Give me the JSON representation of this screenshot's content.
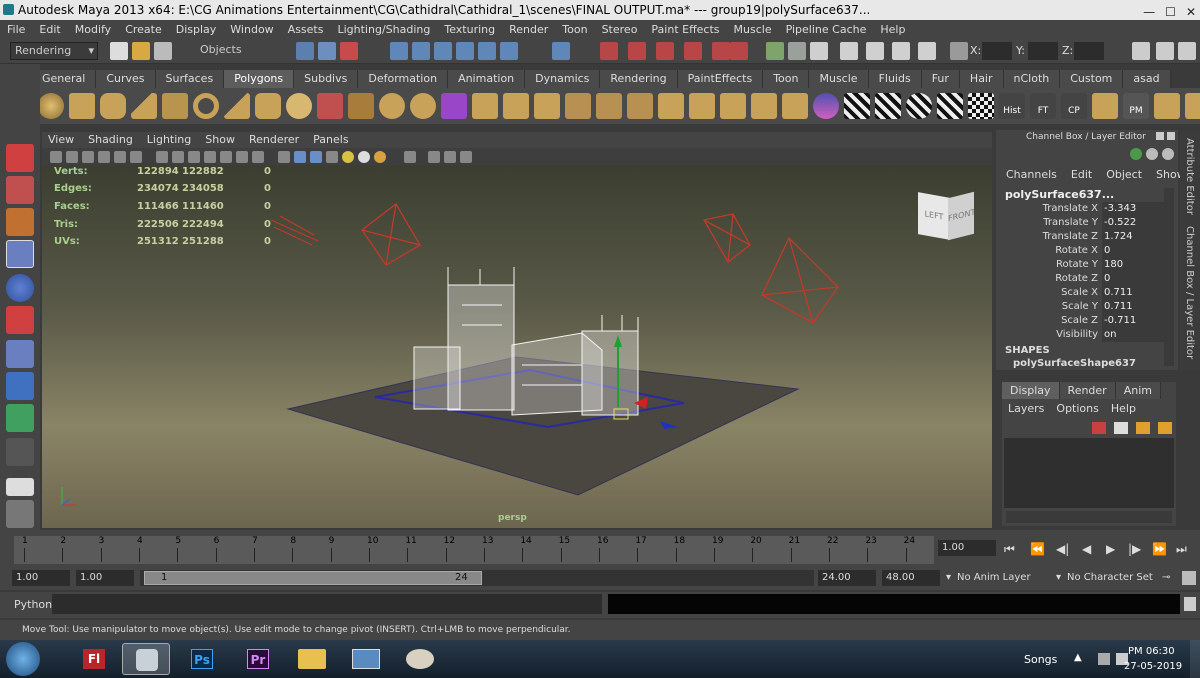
{
  "window": {
    "title": "Autodesk Maya 2013 x64: E:\\CG Animations Entertainment\\CG\\Cathidral\\Cathidral_1\\scenes\\FINAL OUTPUT.ma*   ---   group19|polySurface637...",
    "minimize": "—",
    "maximize": "☐",
    "close": "✕"
  },
  "menubar": [
    "File",
    "Edit",
    "Modify",
    "Create",
    "Display",
    "Window",
    "Assets",
    "Lighting/Shading",
    "Texturing",
    "Render",
    "Toon",
    "Stereo",
    "Paint Effects",
    "Muscle",
    "Pipeline Cache",
    "Help"
  ],
  "statusline": {
    "mode_menu": "Rendering",
    "selection_mask": "Objects",
    "x_label": "X:",
    "y_label": "Y:",
    "z_label": "Z:"
  },
  "shelf": {
    "tabs": [
      "General",
      "Curves",
      "Surfaces",
      "Polygons",
      "Subdivs",
      "Deformation",
      "Animation",
      "Dynamics",
      "Rendering",
      "PaintEffects",
      "Toon",
      "Muscle",
      "Fluids",
      "Fur",
      "Hair",
      "nCloth",
      "Custom",
      "asad"
    ],
    "active_tab": "Polygons",
    "text_icons": [
      "Hist",
      "FT",
      "CP",
      "PM"
    ]
  },
  "viewport": {
    "menu": [
      "View",
      "Shading",
      "Lighting",
      "Show",
      "Renderer",
      "Panels"
    ],
    "hud": [
      {
        "label": "Verts:",
        "a": "122894",
        "b": "122882",
        "c": "0"
      },
      {
        "label": "Edges:",
        "a": "234074",
        "b": "234058",
        "c": "0"
      },
      {
        "label": "Faces:",
        "a": "111466",
        "b": "111460",
        "c": "0"
      },
      {
        "label": "Tris:",
        "a": "222506",
        "b": "222494",
        "c": "0"
      },
      {
        "label": "UVs:",
        "a": "251312",
        "b": "251288",
        "c": "0"
      }
    ],
    "camera_name": "persp",
    "viewcube_left": "LEFT",
    "viewcube_front": "FRONT"
  },
  "channel_box": {
    "header": "Channel Box / Layer Editor",
    "menu": [
      "Channels",
      "Edit",
      "Object",
      "Show"
    ],
    "object_name": "polySurface637...",
    "attributes": [
      {
        "name": "Translate X",
        "value": "-3.343"
      },
      {
        "name": "Translate Y",
        "value": "-0.522"
      },
      {
        "name": "Translate Z",
        "value": "1.724"
      },
      {
        "name": "Rotate X",
        "value": "0"
      },
      {
        "name": "Rotate Y",
        "value": "180"
      },
      {
        "name": "Rotate Z",
        "value": "0"
      },
      {
        "name": "Scale X",
        "value": "0.711"
      },
      {
        "name": "Scale Y",
        "value": "0.711"
      },
      {
        "name": "Scale Z",
        "value": "-0.711"
      },
      {
        "name": "Visibility",
        "value": "on"
      }
    ],
    "shapes_label": "SHAPES",
    "shape_name": "polySurfaceShape637",
    "side_tab_attribute": "Attribute Editor",
    "side_tab_channel": "Channel Box / Layer Editor"
  },
  "layer_editor": {
    "tabs": [
      "Display",
      "Render",
      "Anim"
    ],
    "active_tab": "Display",
    "menu": [
      "Layers",
      "Options",
      "Help"
    ]
  },
  "time_slider": {
    "ticks": [
      "1",
      "2",
      "3",
      "4",
      "5",
      "6",
      "7",
      "8",
      "9",
      "10",
      "11",
      "12",
      "13",
      "14",
      "15",
      "16",
      "17",
      "18",
      "19",
      "20",
      "21",
      "22",
      "23",
      "24"
    ],
    "current_time": "1.00"
  },
  "range_slider": {
    "start_time": "1.00",
    "playback_start": "1.00",
    "range_start_label": "1",
    "range_end_label": "24",
    "playback_end": "24.00",
    "end_time": "48.00",
    "anim_layer": "No Anim Layer",
    "character_set": "No Character Set"
  },
  "command_line": {
    "language": "Python"
  },
  "help_line": "Move Tool: Use manipulator to move object(s). Use edit mode to change pivot (INSERT).  Ctrl+LMB to move perpendicular.",
  "taskbar": {
    "apps": [
      "Fl",
      "Ps",
      "Pr"
    ],
    "tray_label": "Songs",
    "time": "PM 06:30",
    "date": "27-05-2019"
  }
}
